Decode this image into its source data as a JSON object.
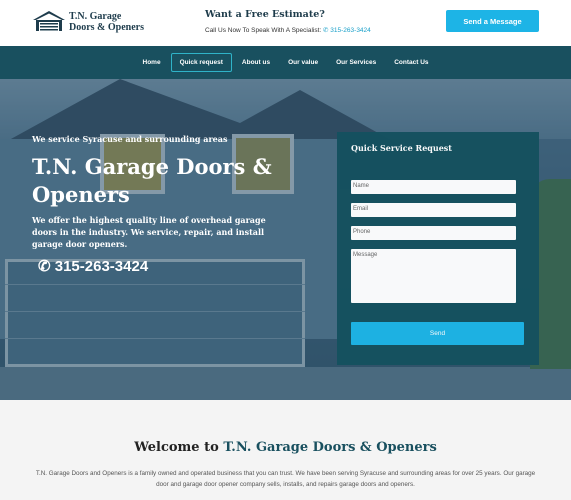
{
  "header": {
    "logo_line1": "T.N. Garage",
    "logo_line2": "Doors & Openers",
    "estimate_title": "Want a Free Estimate?",
    "estimate_sub": "Call Us Now To Speak With A Specialist:",
    "estimate_phone": "315-263-3424",
    "send_message_label": "Send a Message"
  },
  "nav": {
    "items": [
      {
        "label": "Home"
      },
      {
        "label": "Quick request"
      },
      {
        "label": "About us"
      },
      {
        "label": "Our value"
      },
      {
        "label": "Our Services"
      },
      {
        "label": "Contact Us"
      }
    ],
    "active_index": 1
  },
  "hero": {
    "small_heading": "We service Syracuse and surrounding areas",
    "title": "T.N. Garage Doors & Openers",
    "description": "We offer the highest quality line of overhead garage doors in the industry. We service, repair, and install garage door openers.",
    "phone": "315-263-3424"
  },
  "form": {
    "title": "Quick Service Request",
    "name_placeholder": "Name",
    "email_placeholder": "Email",
    "phone_placeholder": "Phone",
    "message_placeholder": "Message",
    "send_label": "Send"
  },
  "welcome": {
    "title_prefix": "Welcome to",
    "title_brand": "T.N. Garage Doors & Openers",
    "text": "T.N. Garage Doors and Openers is a family owned and operated business that you can trust. We have been serving Syracuse and surrounding areas for over 25 years. Our garage door and garage door opener company sells, installs, and repairs garage doors and openers."
  },
  "colors": {
    "accent": "#1db4e6",
    "nav_bg": "#19505f",
    "brand_dark": "#1e3c4c"
  },
  "icons": {
    "logo": "garage-house-icon",
    "phone": "phone-icon"
  }
}
